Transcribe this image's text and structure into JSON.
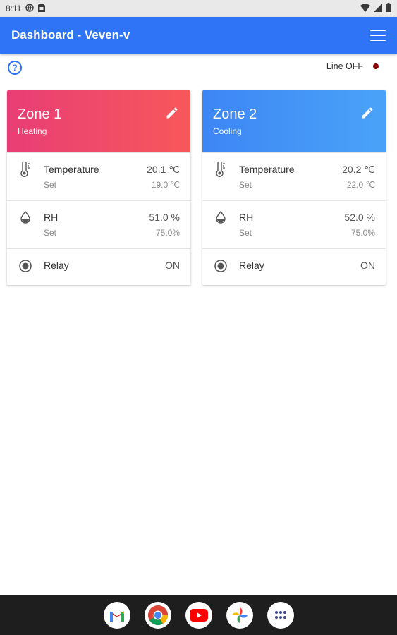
{
  "status_bar": {
    "time": "8:11"
  },
  "app_bar": {
    "title": "Dashboard - Veven-v"
  },
  "help": {
    "glyph": "?"
  },
  "line_status": {
    "label": "Line OFF",
    "indicator_color": "#8b0000"
  },
  "zones": [
    {
      "name": "Zone 1",
      "mode": "Heating",
      "temperature": {
        "label": "Temperature",
        "value": "20.1 ℃",
        "set_label": "Set",
        "set_value": "19.0 ℃"
      },
      "rh": {
        "label": "RH",
        "value": "51.0 %",
        "set_label": "Set",
        "set_value": "75.0%"
      },
      "relay": {
        "label": "Relay",
        "value": "ON"
      }
    },
    {
      "name": "Zone 2",
      "mode": "Cooling",
      "temperature": {
        "label": "Temperature",
        "value": "20.2 ℃",
        "set_label": "Set",
        "set_value": "22.0 ℃"
      },
      "rh": {
        "label": "RH",
        "value": "52.0 %",
        "set_label": "Set",
        "set_value": "75.0%"
      },
      "relay": {
        "label": "Relay",
        "value": "ON"
      }
    }
  ],
  "dock": [
    "gmail-icon",
    "chrome-icon",
    "youtube-icon",
    "photos-icon",
    "app-drawer-icon"
  ],
  "colors": {
    "app_bar": "#2f73f7",
    "zone1_gradient": [
      "#e83e76",
      "#f7585a"
    ],
    "zone2_gradient": [
      "#3d86f5",
      "#4aa3f8"
    ]
  }
}
